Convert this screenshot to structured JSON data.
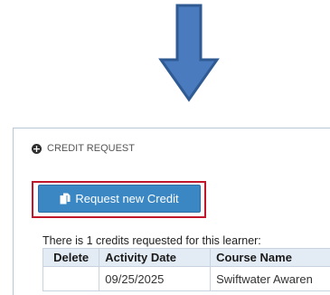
{
  "panel": {
    "title": "CREDIT REQUEST",
    "toggle_icon": "plus-circle-icon"
  },
  "request_button": {
    "label": "Request new Credit",
    "icon": "document-icon",
    "highlight_color": "#c0182a",
    "button_color": "#3a87c4"
  },
  "arrow": {
    "icon": "down-arrow-icon",
    "color": "#4a7bbf"
  },
  "credits": {
    "summary": "There is 1 credits requested for this learner:",
    "columns": [
      "Delete",
      "Activity Date",
      "Course Name"
    ],
    "rows": [
      {
        "delete": "",
        "activity_date": "09/25/2025",
        "course_name": "Swiftwater Awaren"
      }
    ]
  }
}
